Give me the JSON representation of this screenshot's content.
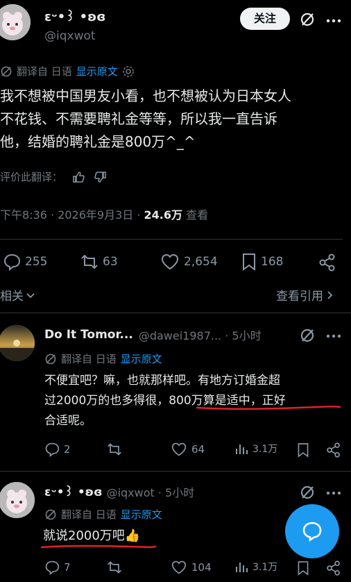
{
  "main_post": {
    "display_name": "ɛᵕ•꒱ •ʚɞ",
    "handle": "@iqxwot",
    "follow_label": "关注",
    "translated_from": "翻译自 日语",
    "show_original": "显示原文",
    "text_lines": [
      "我不想被中国男友小看，也不想被认为日本女人",
      "不花钱、不需要聘礼金等等，所以我一直告诉",
      "他，结婚的聘礼金是800万^_^"
    ],
    "rate_translation": "评价此翻译：",
    "timestamp": "下午8:36 · 2026年9月3日 · ",
    "views_count": "24.6万",
    "views_label": " 查看",
    "replies": "255",
    "reposts": "63",
    "likes": "2,654",
    "bookmarks": "168",
    "related_label": "相关",
    "view_quotes_label": "查看引用"
  },
  "replies": [
    {
      "display_name": "Do It Tomor...",
      "handle_time": "@dawei1987... · 5小时",
      "translated_from": "翻译自 日语",
      "show_original": "显示原文",
      "text_lines": [
        "不便宜吧？嘛，也就那样吧。有地方订婚金超",
        "过2000万的也多得很，800万算是适中，正好",
        "合适呢。"
      ],
      "reply_count": "2",
      "repost_count": "",
      "like_count": "64",
      "views": "3.1万"
    },
    {
      "display_name": "ɛᵕ•꒱ •ʚɞ",
      "handle_time": "@iqxwot · 5小时",
      "translated_from": "翻译自 日语",
      "show_original": "显示原文",
      "text": "就说2000万吧👍",
      "reply_count": "7",
      "repost_count": "",
      "like_count": "104",
      "views": "3.1万"
    }
  ],
  "colors": {
    "link": "#1d9bf0",
    "underline": "#e0202a",
    "background": "#000000"
  }
}
